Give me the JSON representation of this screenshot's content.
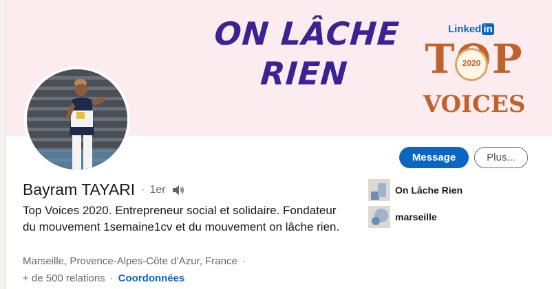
{
  "banner": {
    "slogan_line1": "ON LÂCHE",
    "slogan_line2": "RIEN",
    "badge_brand": "Linked",
    "badge_brand_in": "in",
    "badge_top": "TOP",
    "badge_year": "2020",
    "badge_voices": "VOICES"
  },
  "actions": {
    "message_label": "Message",
    "more_label": "Plus..."
  },
  "profile": {
    "name": "Bayram TAYARI",
    "separator": "·",
    "degree": "1er",
    "headline": "Top Voices 2020. Entrepreneur social et solidaire. Fondateur du mouvement 1semaine1cv et du mouvement on lâche rien.",
    "location": "Marseille, Provence-Alpes-Côte d’Azur, France",
    "relations": "+ de 500 relations",
    "contact_link": "Coordonnées"
  },
  "organizations": [
    {
      "name": "On Lâche Rien",
      "icon": "company-logo-icon"
    },
    {
      "name": "marseille",
      "icon": "school-logo-icon"
    }
  ],
  "colors": {
    "accent": "#0a66c2",
    "banner_bg": "#fcecef",
    "slogan": "#3b2391",
    "badge": "#c0622b"
  }
}
